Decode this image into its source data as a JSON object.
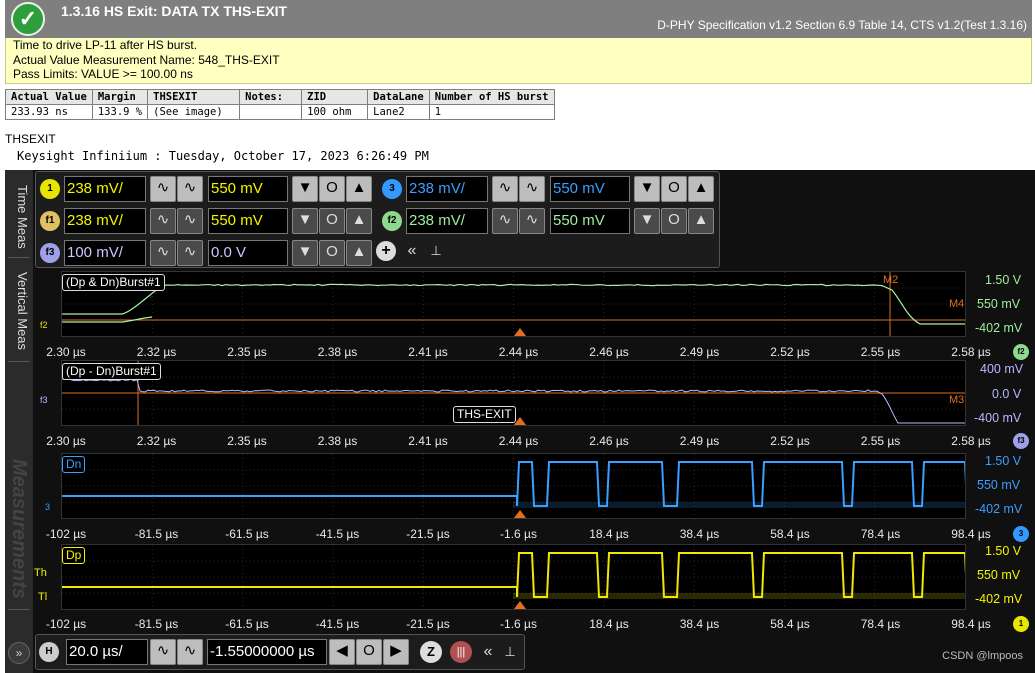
{
  "report": {
    "title": "1.3.16 HS Exit: DATA TX THS-EXIT",
    "spec_ref": "D-PHY Specification v1.2 Section 6.9 Table 14, CTS v1.2(Test 1.3.16)",
    "desc_line1": "Time to drive LP-11 after HS burst.",
    "desc_line2": "Actual Value Measurement Name: 548_THS-EXIT",
    "desc_line3": "Pass Limits: VALUE >= 100.00 ns",
    "status": "pass"
  },
  "results_table": {
    "headers": [
      "Actual Value",
      "Margin",
      "THSEXIT",
      "Notes:",
      "ZID",
      "DataLane",
      "Number of HS burst"
    ],
    "row": [
      "233.93 ns",
      "133.9 %",
      "(See image)",
      "",
      "100 ohm",
      "Lane2",
      "1"
    ]
  },
  "measurement_title": "THSEXIT",
  "scope_line": "Keysight Infiniium : Tuesday, October 17, 2023 6:26:49 PM",
  "side_tabs": {
    "tab1": "Time Meas",
    "tab2": "Vertical Meas",
    "tab3": "Measurements"
  },
  "channels": [
    {
      "badge": "1",
      "scale": "238 mV/",
      "offset": "550 mV",
      "color": "#f5f500",
      "badge_bg": "#e6e600"
    },
    {
      "badge": "3",
      "scale": "238 mV/",
      "offset": "550 mV",
      "color": "#3aa0ff",
      "badge_bg": "#3399ff"
    },
    {
      "badge": "f1",
      "scale": "238 mV/",
      "offset": "550 mV",
      "color": "#f5f500",
      "badge_bg": "#e0c060"
    },
    {
      "badge": "f2",
      "scale": "238 mV/",
      "offset": "550 mV",
      "color": "#9ef09e",
      "badge_bg": "#8fd88f"
    },
    {
      "badge": "f3",
      "scale": "100 mV/",
      "offset": "0.0 V",
      "color": "#f5f500",
      "badge_bg": "#a0a0e8"
    }
  ],
  "time_axis_top": [
    "2.30 µs",
    "2.32 µs",
    "2.35 µs",
    "2.38 µs",
    "2.41 µs",
    "2.44 µs",
    "2.46 µs",
    "2.49 µs",
    "2.52 µs",
    "2.55 µs",
    "2.58 µs"
  ],
  "time_axis_bottom": [
    "-102 µs",
    "-81.5 µs",
    "-61.5 µs",
    "-41.5 µs",
    "-21.5 µs",
    "-1.6 µs",
    "18.4 µs",
    "38.4 µs",
    "58.4 µs",
    "78.4 µs",
    "98.4 µs"
  ],
  "plot1": {
    "label": "(Dp & Dn)Burst#1",
    "scale_top": "1.50 V",
    "scale_mid": "550 mV",
    "scale_bot": "-402 mV",
    "marker_a": "M2",
    "marker_b": "M4",
    "ref_badge": "f2",
    "left_marker": "f2"
  },
  "plot2": {
    "label": "(Dp - Dn)Burst#1",
    "scale_top": "400 mV",
    "scale_mid": "0.0 V",
    "scale_bot": "-400 mV",
    "marker_a": "M3",
    "ref_badge": "f3",
    "left_marker": "f3",
    "annotation": "THS-EXIT"
  },
  "plot3": {
    "label": "Dn",
    "scale_top": "1.50 V",
    "scale_mid": "550 mV",
    "scale_bot": "-402 mV",
    "ref_badge": "3",
    "left_marker": "3"
  },
  "plot4": {
    "label": "Dp",
    "scale_top": "1.50 V",
    "scale_mid": "550 mV",
    "scale_bot": "-402 mV",
    "ref_badge": "1",
    "left_marker_a": "Th",
    "left_marker_b": "Tl"
  },
  "horizontal": {
    "badge": "H",
    "scale": "20.0 µs/",
    "position": "-1.55000000 µs"
  },
  "watermark": "CSDN @lmpoos"
}
